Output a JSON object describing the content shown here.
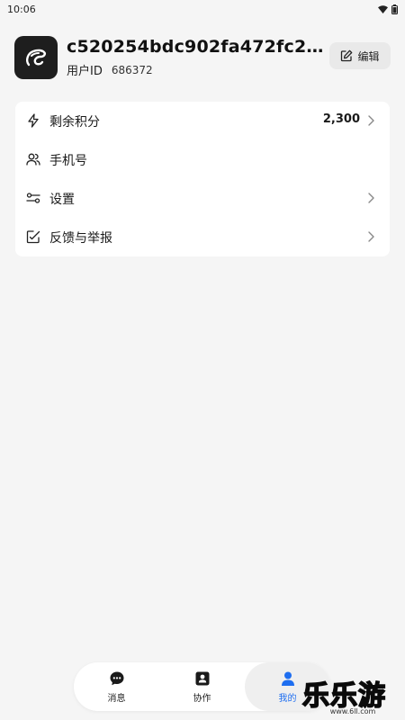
{
  "status_bar": {
    "time": "10:06"
  },
  "profile": {
    "username": "c520254bdc902fa472fc226…",
    "uid_label": "用户ID",
    "uid_value": "686372",
    "edit_label": "编辑"
  },
  "menu": {
    "items": [
      {
        "label": "剩余积分",
        "value": "2,300",
        "icon": "lightning-icon",
        "has_chevron": true
      },
      {
        "label": "手机号",
        "icon": "users-icon",
        "has_chevron": false
      },
      {
        "label": "设置",
        "icon": "sliders-icon",
        "has_chevron": true
      },
      {
        "label": "反馈与举报",
        "icon": "feedback-edit-icon",
        "has_chevron": true
      }
    ]
  },
  "bottom_nav": {
    "items": [
      {
        "label": "消息",
        "icon": "chat-bubble-icon",
        "active": false
      },
      {
        "label": "协作",
        "icon": "contact-card-icon",
        "active": false
      },
      {
        "label": "我的",
        "icon": "person-icon",
        "active": true
      }
    ]
  },
  "watermark": {
    "text": "乐乐游戏",
    "url": "www.6ll.com"
  },
  "colors": {
    "accent": "#1e6ef0",
    "background": "#f5f5f5",
    "card": "#ffffff"
  }
}
